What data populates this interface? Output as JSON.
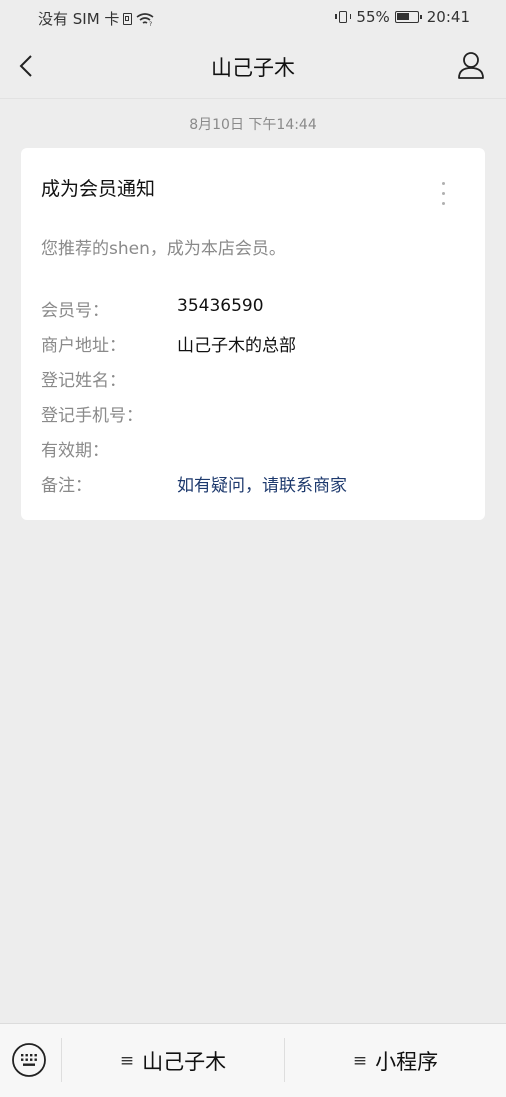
{
  "status_bar": {
    "carrier": "没有 SIM 卡",
    "battery": "55%",
    "time": "20:41"
  },
  "nav": {
    "title": "山己子木",
    "back_icon": "chevron-left-icon",
    "profile_icon": "person-icon"
  },
  "timestamp": "8月10日 下午14:44",
  "card": {
    "title": "成为会员通知",
    "description": "您推荐的shen，成为本店会员。",
    "fields": [
      {
        "label": "会员号：",
        "value": "35436590"
      },
      {
        "label": "商户地址：",
        "value": "山己子木的总部"
      },
      {
        "label": "登记姓名：",
        "value": ""
      },
      {
        "label": "登记手机号：",
        "value": ""
      },
      {
        "label": "有效期：",
        "value": ""
      },
      {
        "label": "备注：",
        "value": "如有疑问，请联系商家"
      }
    ]
  },
  "bottom_bar": {
    "menu_glyph": "≡",
    "menu_1": "山己子木",
    "menu_2": "小程序"
  },
  "colors": {
    "background": "#ededed",
    "card": "#ffffff",
    "link": "#1e3a6e",
    "muted": "#8a8a8a"
  }
}
